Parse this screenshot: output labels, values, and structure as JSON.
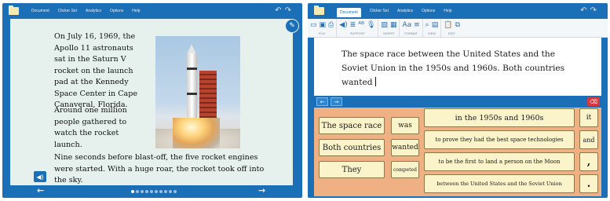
{
  "left_panel": {
    "menu": [
      "Document",
      "Clicker Set",
      "Analytics",
      "Options",
      "Help"
    ],
    "page": {
      "para1": "On July 16, 1969, the Apollo 11 astronauts sat in the Saturn V rocket on the launch pad at the Kennedy Space Center in Cape Canaveral, Florida.",
      "para2": "Around one million people gathered to watch the rocket launch.",
      "para3": "Nine seconds before blast-off, the five rocket engines were started. With a huge roar, the rocket took off into the sky."
    },
    "page_indicator": {
      "count": 10,
      "active_index": 0
    }
  },
  "right_panel": {
    "menu": [
      "Document",
      "Clicker Set",
      "Analytics",
      "Options",
      "Help"
    ],
    "toolbar_groups": [
      "FILE",
      "SUPPORT",
      "INSERT",
      "FORMAT",
      "VIEW",
      "EDIT"
    ],
    "writing_text": "The space race between the United States and the Soviet Union in the 1950s and 1960s. Both countries wanted",
    "cells": {
      "c1": "The space race",
      "c2": "Both countries",
      "c3": "They",
      "c4": "was",
      "c5": "wanted",
      "c6": "competed",
      "c7": "in the 1950s and 1960s",
      "c8": "to prove they had the best space technologies",
      "c9": "to be the first to land a person on the Moon",
      "c10": "between the United States and the Soviet Union",
      "c11": "it",
      "c12": "and",
      "c13": ",",
      "c14": "."
    }
  },
  "colors": {
    "frame_blue": "#1b6fb6",
    "page_bg": "#e6f1ee",
    "cell_bg": "#fbf3c9",
    "grid_bg": "#efb084",
    "delete_red": "#d9363e"
  }
}
